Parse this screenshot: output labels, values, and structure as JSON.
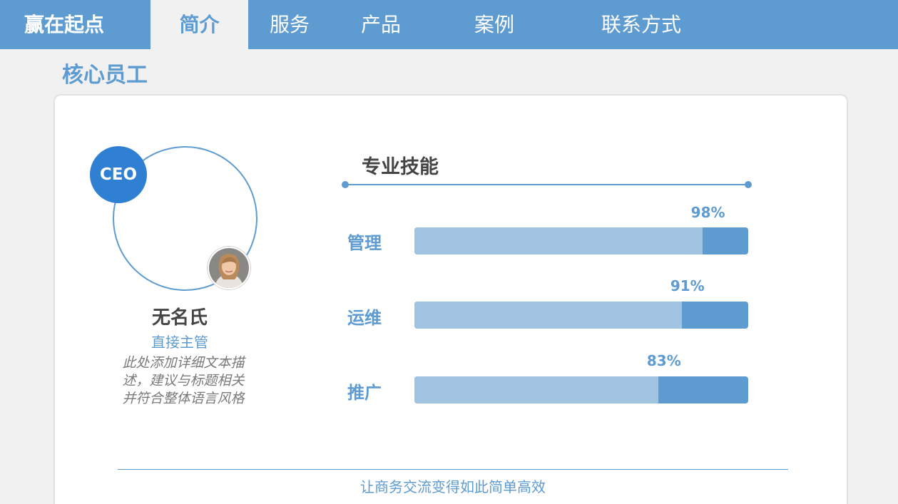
{
  "nav": {
    "brand": "赢在起点",
    "items": [
      {
        "label": "简介",
        "active": true
      },
      {
        "label": "服务",
        "active": false
      },
      {
        "label": "产品",
        "active": false
      },
      {
        "label": "案例",
        "active": false
      },
      {
        "label": "联系方式",
        "active": false
      }
    ]
  },
  "section": {
    "title": "核心员工"
  },
  "profile": {
    "badge": "CEO",
    "name": "无名氏",
    "role": "直接主管",
    "description_lines": [
      "此处添加详细文本描",
      "述，建议与标题相关",
      "并符合整体语言风格"
    ]
  },
  "skills": {
    "title": "专业技能",
    "items": [
      {
        "label": "管理",
        "percent": 98,
        "percent_text": "98%"
      },
      {
        "label": "运维",
        "percent": 91,
        "percent_text": "91%"
      },
      {
        "label": "推广",
        "percent": 83,
        "percent_text": "83%"
      }
    ]
  },
  "footer": {
    "tagline": "让商务交流变得如此简单高效"
  },
  "colors": {
    "accent": "#5e9bd0",
    "bar_fill": "#a1c3e2",
    "badge": "#2f7fd2",
    "background": "#f1f1f1"
  }
}
